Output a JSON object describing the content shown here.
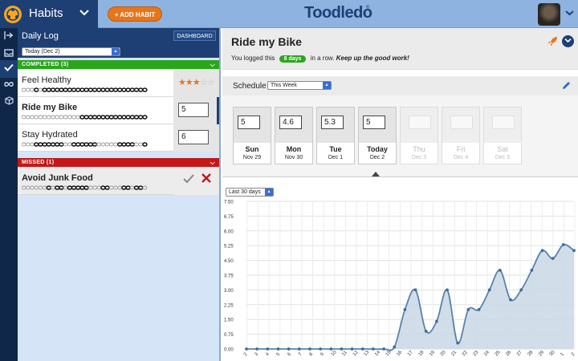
{
  "header": {
    "app_title": "Habits",
    "add_habit_label": "+ ADD HABIT",
    "brand": "Toodledo",
    "brand_mark": "®"
  },
  "rail": {
    "icons": [
      "collapse-icon",
      "inbox-icon",
      "check-icon",
      "infinity-icon",
      "box-icon"
    ]
  },
  "left": {
    "title": "Daily Log",
    "dashboard_label": "DASHBOARD",
    "date_select": "Today (Dec 2)",
    "completed_label": "COMPLETED (3)",
    "missed_label": "MISSED (1)",
    "habits": [
      {
        "name": "Feel Healthy",
        "rating": 3,
        "rating_max": 5,
        "chain": [
          0,
          0,
          0,
          1,
          0,
          1,
          1,
          1,
          1,
          1,
          1,
          1,
          1,
          1,
          1,
          1,
          1,
          1,
          1,
          1,
          1,
          1,
          1,
          1,
          1,
          1,
          1,
          1,
          1,
          1
        ]
      },
      {
        "name": "Ride my Bike",
        "value": "5",
        "chain": [
          0,
          0,
          0,
          0,
          0,
          0,
          0,
          0,
          0,
          0,
          0,
          0,
          0,
          0,
          1,
          1,
          1,
          1,
          1,
          1,
          1,
          1,
          1,
          1,
          1,
          1,
          1,
          1,
          1,
          1
        ]
      },
      {
        "name": "Stay Hydrated",
        "value": "6",
        "chain": [
          0,
          0,
          0,
          1,
          1,
          1,
          1,
          1,
          1,
          1,
          0,
          0,
          1,
          1,
          1,
          1,
          1,
          1,
          0,
          0,
          0,
          0,
          0,
          1,
          1,
          1,
          1,
          0,
          0,
          1
        ]
      },
      {
        "name": "Avoid Junk Food",
        "chain": [
          0,
          0,
          0,
          0,
          0,
          0,
          1,
          0,
          1,
          1,
          0,
          1,
          1,
          1,
          1,
          1,
          0,
          0,
          0,
          1,
          1,
          0,
          0,
          0,
          1,
          1,
          0,
          1,
          1,
          0
        ]
      }
    ]
  },
  "main": {
    "habit_title": "Ride my Bike",
    "streak_prefix": "You logged this",
    "streak_badge": "8 days",
    "streak_mid": "in a row.",
    "streak_tail": "Keep up the good work!",
    "schedule_label": "Schedule",
    "week_select": "This Week",
    "range_select": "Last 30 days",
    "days": [
      {
        "value": "5",
        "name": "Sun",
        "date": "Nov 29",
        "future": false
      },
      {
        "value": "4.6",
        "name": "Mon",
        "date": "Nov 30",
        "future": false
      },
      {
        "value": "5.3",
        "name": "Tue",
        "date": "Dec 1",
        "future": false
      },
      {
        "value": "5",
        "name": "Today",
        "date": "Dec 2",
        "future": false
      },
      {
        "value": "",
        "name": "Thu",
        "date": "Dec 3",
        "future": true
      },
      {
        "value": "",
        "name": "Fri",
        "date": "Dec 4",
        "future": true
      },
      {
        "value": "",
        "name": "Sat",
        "date": "Dec 5",
        "future": true
      }
    ]
  },
  "colors": {
    "accent_orange": "#e8751a",
    "completed_green": "#2aa61a",
    "missed_red": "#c41818",
    "navy": "#1e3f73",
    "line_blue": "#5a82ad"
  },
  "chart_data": {
    "type": "area",
    "title": "",
    "xlabel": "",
    "ylabel": "",
    "ylim": [
      0,
      7.5
    ],
    "y_ticks": [
      "7.50",
      "6.75",
      "6.00",
      "5.25",
      "4.50",
      "3.75",
      "3.00",
      "2.25",
      "1.50",
      "0.75",
      "0.00"
    ],
    "x": [
      "2",
      "3",
      "4",
      "5",
      "6",
      "7",
      "8",
      "9",
      "10",
      "11",
      "12",
      "13",
      "14",
      "15",
      "16",
      "17",
      "18",
      "19",
      "20",
      "21",
      "22",
      "23",
      "24",
      "25",
      "26",
      "27",
      "28",
      "29",
      "30",
      "1",
      "2"
    ],
    "values": [
      0,
      0,
      0,
      0,
      0,
      0,
      0,
      0,
      0,
      0,
      0,
      0,
      0,
      0,
      0.1,
      2.0,
      3.0,
      0.9,
      1.4,
      3.0,
      0.3,
      2.0,
      2.0,
      3.0,
      4.0,
      2.5,
      3.0,
      4.0,
      5.0,
      4.6,
      5.3,
      5.0
    ],
    "grid": true
  }
}
